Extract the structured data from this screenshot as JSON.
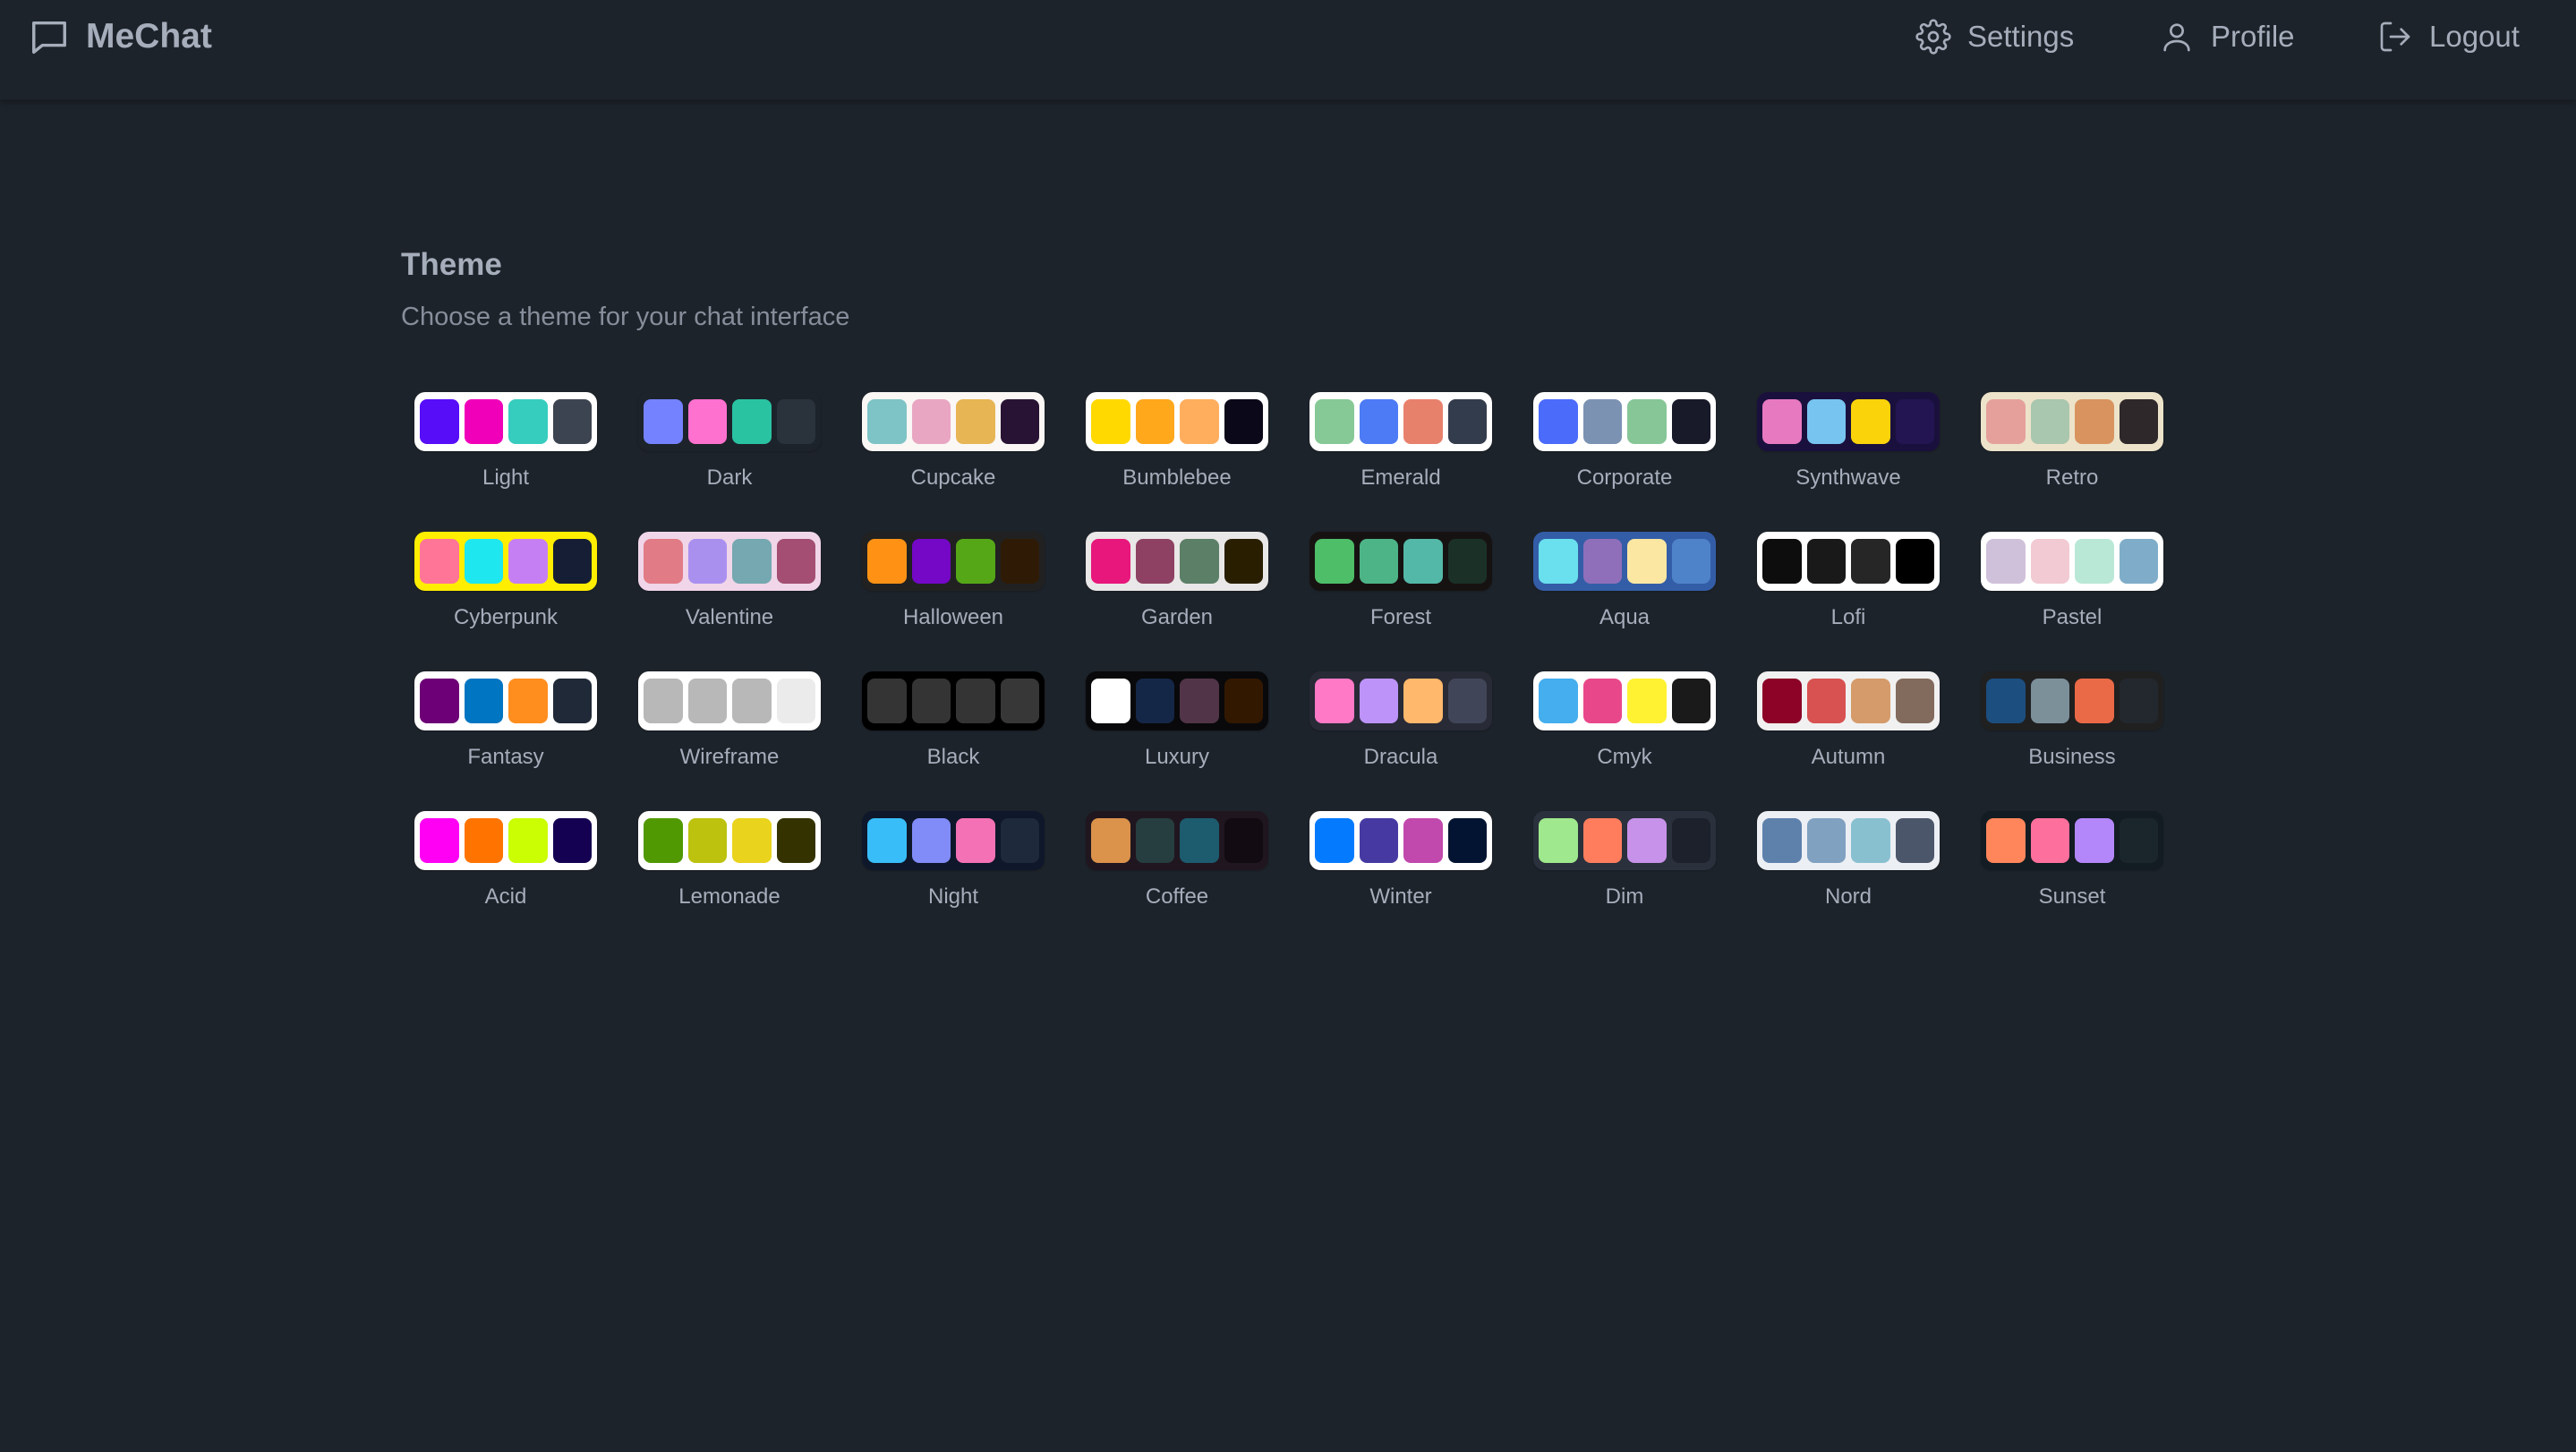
{
  "app": {
    "name": "MeChat"
  },
  "nav": {
    "settings": "Settings",
    "profile": "Profile",
    "logout": "Logout"
  },
  "section": {
    "title": "Theme",
    "subtitle": "Choose a theme for your chat interface"
  },
  "themes": [
    {
      "name": "Light",
      "bg": "#ffffff",
      "colors": [
        "#570df8",
        "#f000b8",
        "#37cdbe",
        "#3d4451"
      ]
    },
    {
      "name": "Dark",
      "bg": "#1d232a",
      "colors": [
        "#7582ff",
        "#ff71cf",
        "#2ac3a2",
        "#2a323c"
      ]
    },
    {
      "name": "Cupcake",
      "bg": "#faf7f5",
      "colors": [
        "#7ec3c5",
        "#e9a6c2",
        "#e8b554",
        "#291334"
      ]
    },
    {
      "name": "Bumblebee",
      "bg": "#ffffff",
      "colors": [
        "#ffd900",
        "#ffa81c",
        "#ffae5e",
        "#0b0819"
      ]
    },
    {
      "name": "Emerald",
      "bg": "#ffffff",
      "colors": [
        "#86c996",
        "#4c7bf5",
        "#e8816c",
        "#333c4d"
      ]
    },
    {
      "name": "Corporate",
      "bg": "#ffffff",
      "colors": [
        "#4b6bfb",
        "#7b92b2",
        "#86c697",
        "#181a2a"
      ]
    },
    {
      "name": "Synthwave",
      "bg": "#1a103d",
      "colors": [
        "#e779c1",
        "#77c4f0",
        "#fad30a",
        "#221551"
      ]
    },
    {
      "name": "Retro",
      "bg": "#ece3ca",
      "colors": [
        "#e5a09c",
        "#a9c6ae",
        "#d9935f",
        "#2e282a"
      ]
    },
    {
      "name": "Cyberpunk",
      "bg": "#ffee00",
      "colors": [
        "#ff7598",
        "#1ee7ef",
        "#c67ff2",
        "#161e36"
      ]
    },
    {
      "name": "Valentine",
      "bg": "#f0d6e8",
      "colors": [
        "#e17b86",
        "#a990ef",
        "#75a8b0",
        "#a34e72"
      ]
    },
    {
      "name": "Halloween",
      "bg": "#212121",
      "colors": [
        "#ff9215",
        "#7408c6",
        "#55a718",
        "#2f1b05"
      ]
    },
    {
      "name": "Garden",
      "bg": "#e9e7e7",
      "colors": [
        "#e8177b",
        "#8e4162",
        "#5c7f67",
        "#291e00"
      ]
    },
    {
      "name": "Forest",
      "bg": "#171212",
      "colors": [
        "#4ebe68",
        "#4db487",
        "#54b8a8",
        "#1b3128"
      ]
    },
    {
      "name": "Aqua",
      "bg": "#345da7",
      "colors": [
        "#6ae0ee",
        "#8f6fb9",
        "#fce7a2",
        "#4f83c9"
      ]
    },
    {
      "name": "Lofi",
      "bg": "#ffffff",
      "colors": [
        "#0d0d0d",
        "#1a1919",
        "#262626",
        "#000000"
      ]
    },
    {
      "name": "Pastel",
      "bg": "#ffffff",
      "colors": [
        "#d0c1da",
        "#f2cad3",
        "#b9e8d6",
        "#7fadc9"
      ]
    },
    {
      "name": "Fantasy",
      "bg": "#ffffff",
      "colors": [
        "#6d0076",
        "#0075c2",
        "#ff8e1e",
        "#1f2937"
      ]
    },
    {
      "name": "Wireframe",
      "bg": "#ffffff",
      "colors": [
        "#b8b8b8",
        "#b8b8b8",
        "#b8b8b8",
        "#ebebeb"
      ]
    },
    {
      "name": "Black",
      "bg": "#000000",
      "colors": [
        "#343434",
        "#343434",
        "#343434",
        "#373737"
      ]
    },
    {
      "name": "Luxury",
      "bg": "#09090b",
      "colors": [
        "#ffffff",
        "#152747",
        "#513448",
        "#331800"
      ]
    },
    {
      "name": "Dracula",
      "bg": "#282a36",
      "colors": [
        "#ff79c6",
        "#bd93f9",
        "#ffb86c",
        "#414558"
      ]
    },
    {
      "name": "Cmyk",
      "bg": "#ffffff",
      "colors": [
        "#45aeee",
        "#e8488a",
        "#fff232",
        "#1a1a1a"
      ]
    },
    {
      "name": "Autumn",
      "bg": "#f1f1f1",
      "colors": [
        "#8c0327",
        "#d85251",
        "#d59b6a",
        "#826a5c"
      ]
    },
    {
      "name": "Business",
      "bg": "#202020",
      "colors": [
        "#1c4e80",
        "#7c909a",
        "#ea6947",
        "#23282e"
      ]
    },
    {
      "name": "Acid",
      "bg": "#ffffff",
      "colors": [
        "#ff00f4",
        "#ff7400",
        "#cbfd03",
        "#140152"
      ]
    },
    {
      "name": "Lemonade",
      "bg": "#ffffff",
      "colors": [
        "#519903",
        "#bcc20d",
        "#e9d31d",
        "#343300"
      ]
    },
    {
      "name": "Night",
      "bg": "#0f172a",
      "colors": [
        "#38bdf8",
        "#818cf8",
        "#f471b5",
        "#1e293b"
      ]
    },
    {
      "name": "Coffee",
      "bg": "#20161f",
      "colors": [
        "#db924b",
        "#263e3f",
        "#1d5b6e",
        "#120c12"
      ]
    },
    {
      "name": "Winter",
      "bg": "#ffffff",
      "colors": [
        "#047aff",
        "#463aa2",
        "#c149ad",
        "#021431"
      ]
    },
    {
      "name": "Dim",
      "bg": "#2a303c",
      "colors": [
        "#9fe88d",
        "#ff7d5d",
        "#c792e9",
        "#1c212b"
      ]
    },
    {
      "name": "Nord",
      "bg": "#eceff4",
      "colors": [
        "#5e81ac",
        "#81a1c1",
        "#88c0d0",
        "#4c566a"
      ]
    },
    {
      "name": "Sunset",
      "bg": "#121c22",
      "colors": [
        "#ff865b",
        "#fd6f9c",
        "#b387fa",
        "#1b262c"
      ]
    }
  ]
}
